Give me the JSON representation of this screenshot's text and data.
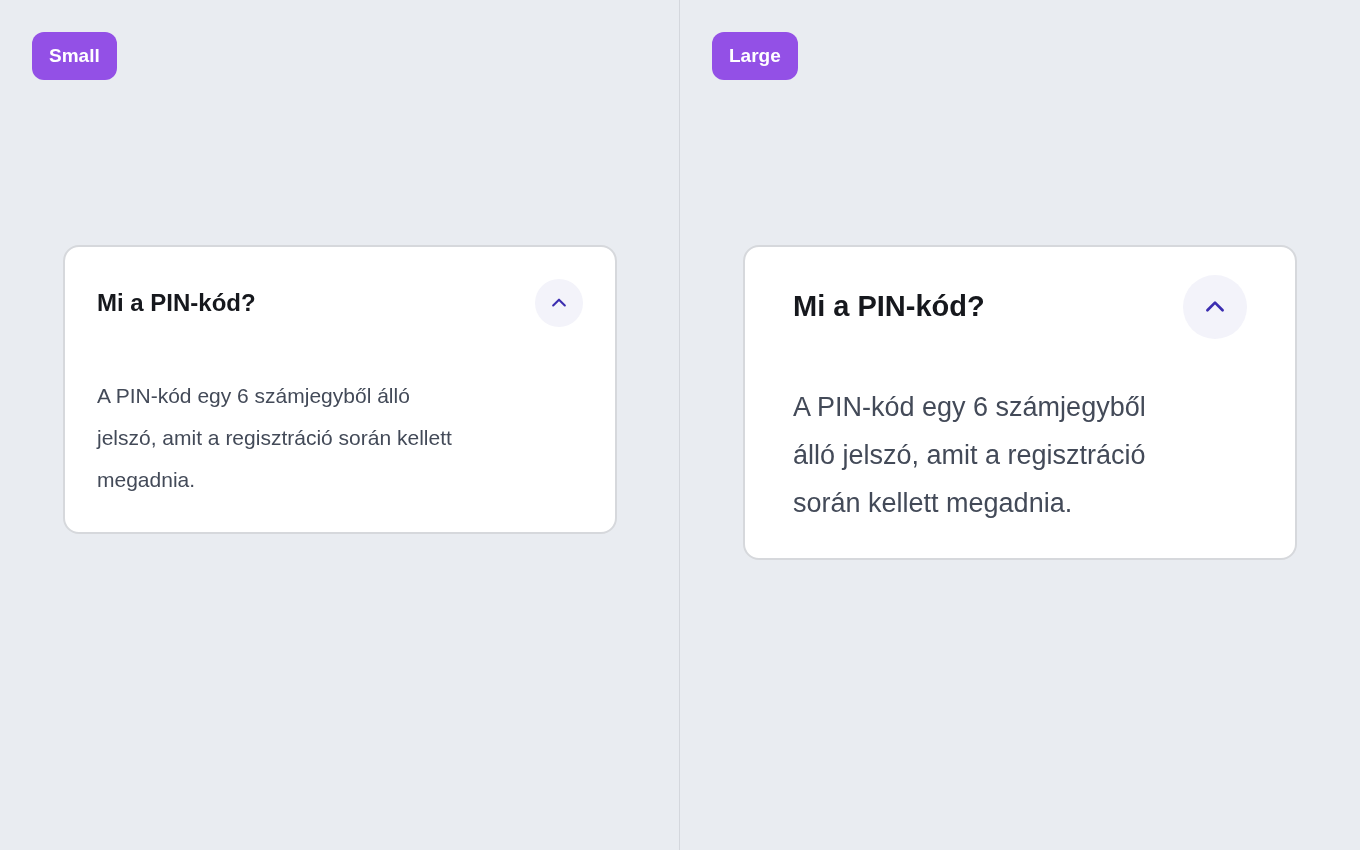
{
  "panels": [
    {
      "badge": "Small",
      "kind": "small",
      "item": {
        "question": "Mi a PIN-kód?",
        "answer": "A PIN-kód egy 6 számjegyből álló jelszó, amit a regisztráció során kellett megadnia.",
        "expanded": true
      }
    },
    {
      "badge": "Large",
      "kind": "large",
      "item": {
        "question": "Mi a PIN-kód?",
        "answer": "A PIN-kód egy 6 számjegyből álló jelszó, amit a regisztráció során kellett megadnia.",
        "expanded": true
      }
    }
  ]
}
